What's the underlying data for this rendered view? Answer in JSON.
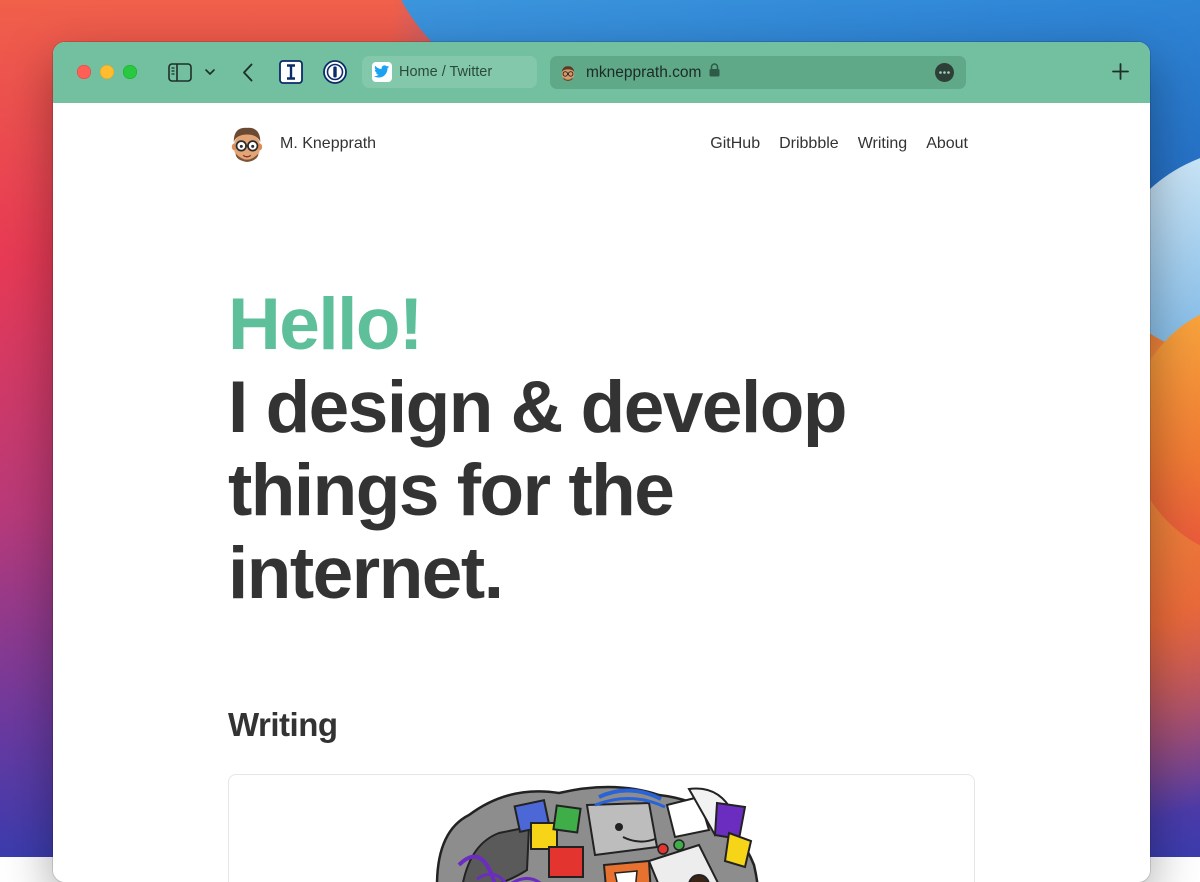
{
  "browser": {
    "tab": {
      "title": "Home / Twitter",
      "favicon": "twitter-bird-icon"
    },
    "address": {
      "url": "mknepprath.com",
      "secure_icon": "lock-icon",
      "more_icon": "ellipsis-circle-icon"
    },
    "toolbar_icons": [
      "sidebar-icon",
      "chevron-down-icon",
      "back-arrow-icon",
      "instapaper-icon",
      "1password-icon",
      "new-tab-plus-icon"
    ],
    "theme_color": "#72c09f"
  },
  "site": {
    "name": "M. Knepprath",
    "nav": [
      "GitHub",
      "Dribbble",
      "Writing",
      "About"
    ],
    "hero": {
      "greeting": "Hello!",
      "lines": [
        "I design & develop",
        "things for the",
        "internet."
      ]
    },
    "accent_color": "#5ec09a",
    "section_title": "Writing"
  }
}
